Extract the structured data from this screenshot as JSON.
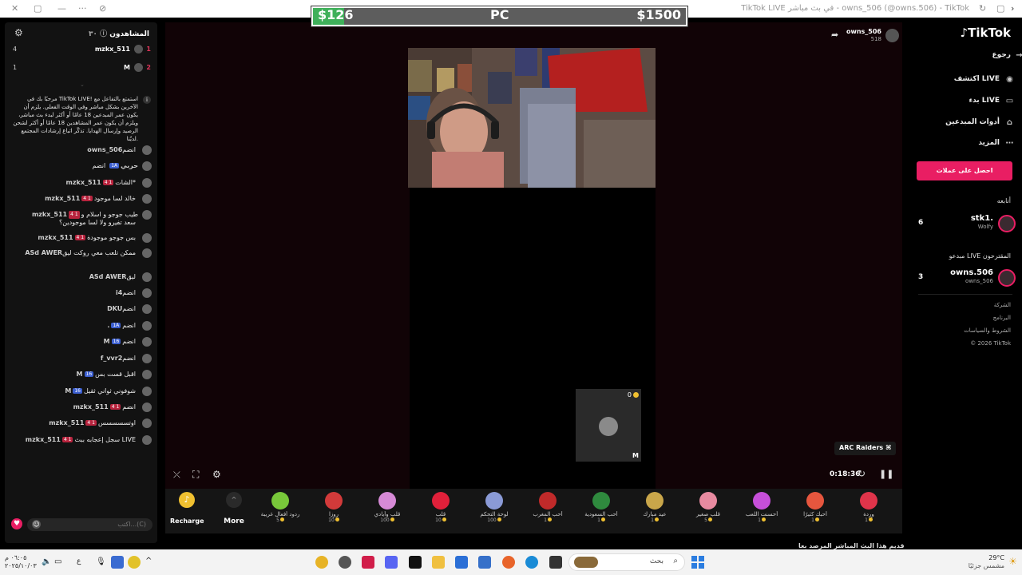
{
  "window": {
    "title": "TikTok LIVE في بث مباشر - owns_506 (@owns.506) - TikTok"
  },
  "overlay": {
    "left_value": "$126",
    "center_label": "PC",
    "right_value": "$1500",
    "progress_fraction": 0.084
  },
  "chat": {
    "viewers_label": "المشاهدون",
    "viewers_count": "٣٠",
    "top_viewers": [
      {
        "rank": "1",
        "name": "mzkx_511",
        "score": "4"
      },
      {
        "rank": "2",
        "name": "M",
        "score": "1"
      }
    ],
    "welcome": "مرحبًا بك في TikTok LIVE! استمتع بالتفاعل مع الآخرين بشكل مباشر وفي الوقت الفعلي. يلزم أن يكون عمر المبدعين 18 عامًا أو أكثر لبدء بث مباشر، ويلزم أن يكون عمر المشاهدين 18 عامًا أو أكثر لشحن الرصيد وإرسال الهدايا. تذكّر اتباع إرشادات المجتمع لديّنا.",
    "messages": [
      {
        "name": "owns_506",
        "badge": "",
        "text": "انضم"
      },
      {
        "name": "حربي",
        "badge": "1A",
        "badge_color": "blue",
        "text": "انضم"
      },
      {
        "name": "mzkx_511",
        "badge": "4 1",
        "text": "الشات*"
      },
      {
        "name": "mzkx_511",
        "badge": "4 1",
        "text": "خالد لسا موجود"
      },
      {
        "name": "mzkx_511",
        "badge": "4 1",
        "text": "طيب جوجو و اسلام و سعد تفيرو ولا لسا موجودين؟"
      },
      {
        "name": "mzkx_511",
        "badge": "4 1",
        "text": "بس جوجو موجودة"
      },
      {
        "name": "ASd AWER",
        "badge": "",
        "text": "ممكن تلعب معي روكت ليق"
      },
      {
        "name": "ASd AWER",
        "badge": "",
        "text": "ليق"
      },
      {
        "name": "i4",
        "badge": "",
        "text": "انضم"
      },
      {
        "name": "DKU",
        "badge": "",
        "text": "انضم"
      },
      {
        "name": ".",
        "badge": "1A",
        "badge_color": "blue",
        "text": "انضم"
      },
      {
        "name": "M",
        "badge": "16",
        "badge_color": "blue",
        "text": "انضم"
      },
      {
        "name": "f_vvr2",
        "badge": "",
        "text": "انضم"
      },
      {
        "name": "M",
        "badge": "16",
        "badge_color": "blue",
        "text": "اقبل قست بس"
      },
      {
        "name": "M",
        "badge": "16",
        "badge_color": "blue",
        "text": "شوفوني ثواني ثقيل"
      },
      {
        "name": "mzkx_511",
        "badge": "4 1",
        "text": "انضم"
      },
      {
        "name": "mzkx_511",
        "badge": "4 1",
        "text": "اوتسسسسس"
      },
      {
        "name": "mzkx_511",
        "badge": "4 1",
        "text": "سجل إعجابه ببث LIVE"
      }
    ],
    "input_placeholder": "اكتب...(C)"
  },
  "stream": {
    "host_name": "owns_506",
    "host_likes": "518",
    "timer": "0:18:36",
    "game_tag": "ARC Raiders",
    "mini_count": "0",
    "mini_label": "M"
  },
  "gifts": [
    {
      "name": "وردة",
      "price": "1",
      "color": "#e0344a"
    },
    {
      "name": "أحبك كثيرًا",
      "price": "1",
      "color": "#e6563e"
    },
    {
      "name": "أحسنت اللعب",
      "price": "1",
      "color": "#c64fd9"
    },
    {
      "name": "قلب صغير",
      "price": "5",
      "color": "#e88aa0"
    },
    {
      "name": "عيد مبارك",
      "price": "1",
      "color": "#c9a64a"
    },
    {
      "name": "أحب السعودية",
      "price": "1",
      "color": "#2f8a3e"
    },
    {
      "name": "أحب المغرب",
      "price": "1",
      "color": "#c02a2a"
    },
    {
      "name": "لوحة التحكم",
      "price": "100",
      "color": "#8a9ad6"
    },
    {
      "name": "قلب",
      "price": "10",
      "color": "#e0203a"
    },
    {
      "name": "قلب وأيادي",
      "price": "100",
      "color": "#d68ad6"
    },
    {
      "name": "روزا",
      "price": "10",
      "color": "#d23a3a"
    },
    {
      "name": "ردود أفعال غريبة",
      "price": "5",
      "color": "#78c83a"
    }
  ],
  "gift_controls": {
    "more_label": "More",
    "recharge_label": "Recharge"
  },
  "sidebar": {
    "brand": "TikTok",
    "back": "رجوع",
    "nav": [
      {
        "label": "اكتشف LIVE",
        "icon": "live-explore-icon"
      },
      {
        "label": "بدء LIVE",
        "icon": "camera-icon"
      },
      {
        "label": "أدوات المبدعين",
        "icon": "home-icon"
      },
      {
        "label": "المزيد",
        "icon": "more-icon"
      }
    ],
    "coins_button": "احصل على عملات",
    "following_heading": "أتابعه",
    "following": [
      {
        "name": "stk1.",
        "sub": "Wolfy",
        "count": "6"
      }
    ],
    "recommended_heading": "مبدعو LIVE المقترحون",
    "recommended": [
      {
        "name": "owns.506",
        "sub": "owns_506",
        "count": "3"
      }
    ],
    "footer_links": [
      "الشركة",
      "البرنامج",
      "الشروط والسياسات",
      "© 2026 TikTok"
    ]
  },
  "bottom_hint": "قديم هذا البث المباشر المرصد بعا",
  "taskbar": {
    "weather_temp": "29°C",
    "weather_desc": "مشمس جزئيًا",
    "search_label": "بحث",
    "time": "٠٦:٠٥ م",
    "date": "٢٠٢٥/١٠/٠٣",
    "lang": "ع"
  }
}
